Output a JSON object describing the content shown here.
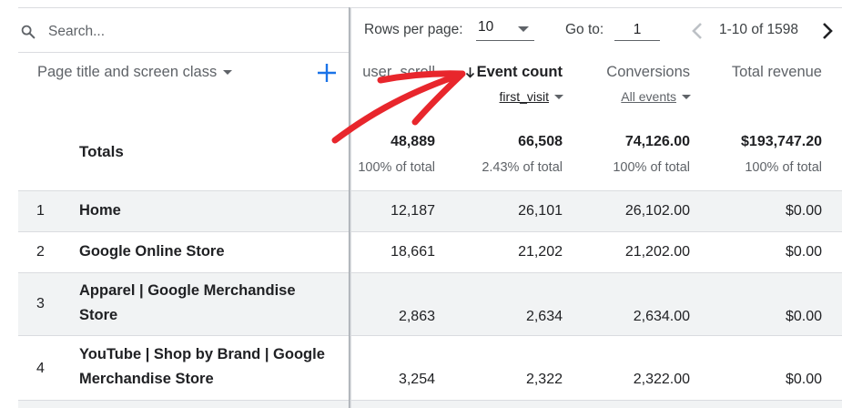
{
  "search": {
    "placeholder": "Search..."
  },
  "pager": {
    "rows_per_page_label": "Rows per page:",
    "rows_per_page_value": "10",
    "goto_label": "Go to:",
    "goto_value": "1",
    "range_text": "1-10 of 1598"
  },
  "dimension_header": {
    "label": "Page title and screen class"
  },
  "columns": [
    {
      "label": "user_scroll",
      "sub": ""
    },
    {
      "label": "Event count",
      "sub": "first_visit",
      "sorted": true
    },
    {
      "label": "Conversions",
      "sub": "All events"
    },
    {
      "label": "Total revenue",
      "sub": ""
    }
  ],
  "totals": {
    "label": "Totals",
    "values": [
      "48,889",
      "66,508",
      "74,126.00",
      "$193,747.20"
    ],
    "percents": [
      "100% of total",
      "2.43% of total",
      "100% of total",
      "100% of total"
    ]
  },
  "rows": [
    {
      "rank": "1",
      "title_line1": "Home",
      "title_line2": "",
      "values": [
        "12,187",
        "26,101",
        "26,102.00",
        "$0.00"
      ]
    },
    {
      "rank": "2",
      "title_line1": "Google Online Store",
      "title_line2": "",
      "values": [
        "18,661",
        "21,202",
        "21,202.00",
        "$0.00"
      ]
    },
    {
      "rank": "3",
      "title_line1": "Apparel | Google Merchandise",
      "title_line2": "Store",
      "values": [
        "2,863",
        "2,634",
        "2,634.00",
        "$0.00"
      ]
    },
    {
      "rank": "4",
      "title_line1": "YouTube | Shop by Brand | Google",
      "title_line2": "Merchandise Store",
      "values": [
        "3,254",
        "2,322",
        "2,322.00",
        "$0.00"
      ]
    }
  ],
  "icons": {
    "search": "search-icon",
    "add": "plus-icon",
    "prev": "chevron-left-icon",
    "next": "chevron-right-icon",
    "sort": "arrow-down-icon",
    "annotation": "red-arrow-annotation"
  },
  "colors": {
    "accent": "#1a73e8",
    "annotation": "#e8262c",
    "grey_row": "#f1f3f4",
    "border": "#dadce0"
  }
}
